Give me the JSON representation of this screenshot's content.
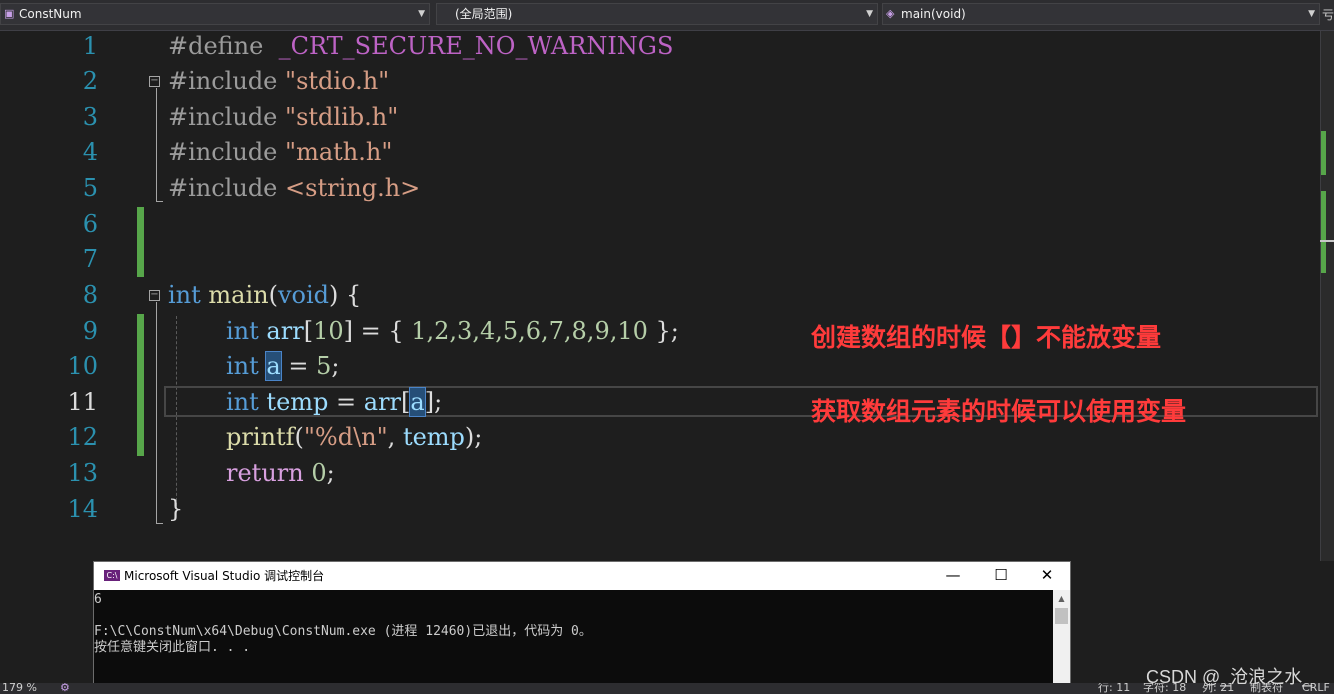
{
  "toolbar": {
    "project_dropdown": "ConstNum",
    "scope_dropdown": "(全局范围)",
    "member_dropdown": "main(void)",
    "right_glyph": "亏"
  },
  "editor": {
    "line_numbers": [
      "1",
      "2",
      "3",
      "4",
      "5",
      "6",
      "7",
      "8",
      "9",
      "10",
      "11",
      "12",
      "13",
      "14"
    ],
    "current_line": "11",
    "lines": {
      "l1": {
        "pp": "#define",
        "mac": "_CRT_SECURE_NO_WARNINGS"
      },
      "l2": {
        "pp": "#include",
        "str": "\"stdio.h\""
      },
      "l3": {
        "pp": "#include",
        "str": "\"stdlib.h\""
      },
      "l4": {
        "pp": "#include",
        "str": "\"math.h\""
      },
      "l5": {
        "pp": "#include",
        "str": "<string.h>"
      },
      "l8": {
        "t1": "int",
        "t2": "main",
        "t3": "(",
        "t4": "void",
        "t5": ") {"
      },
      "l9": {
        "t1": "int",
        "t2": "arr",
        "t3": "[",
        "t4": "10",
        "t5": "] = { ",
        "t6": "1,2,3,4,5,6,7,8,9,10",
        "t7": " };"
      },
      "l10": {
        "t1": "int",
        "t2": "a",
        "t3": " = ",
        "t4": "5",
        "t5": ";"
      },
      "l11": {
        "t1": "int",
        "t2": "temp",
        "t3": " = ",
        "t4": "arr",
        "t5": "[",
        "t6": "a",
        "t7": "];"
      },
      "l12": {
        "t1": "printf",
        "t2": "(",
        "t3": "\"%d\\n\"",
        "t4": ", ",
        "t5": "temp",
        "t6": ");"
      },
      "l13": {
        "t1": "return",
        "t2": " ",
        "t3": "0",
        "t4": ";"
      },
      "l14": {
        "t1": "}"
      }
    }
  },
  "annotations": {
    "first": "创建数组的时候【】不能放变量",
    "second": "获取数组元素的时候可以使用变量"
  },
  "console": {
    "title": "Microsoft Visual Studio 调试控制台",
    "line1": "6",
    "line2": "",
    "line3": "F:\\C\\ConstNum\\x64\\Debug\\ConstNum.exe (进程 12460)已退出，代码为 0。",
    "line4": "按任意键关闭此窗口. . .",
    "minimize": "—",
    "maximize": "☐",
    "close": "✕"
  },
  "statusbar": {
    "zoom": "179 %",
    "row": "行: 11",
    "char": "字符: 18",
    "col": "列: 21",
    "tab": "制表符",
    "eol": "CRLF"
  },
  "watermark": "CSDN @_沧浪之水_",
  "colors": {
    "accent_change_bar": "#57a64a",
    "annotation": "#ff3b3b",
    "keyword": "#569cd6",
    "string": "#d69d85"
  }
}
